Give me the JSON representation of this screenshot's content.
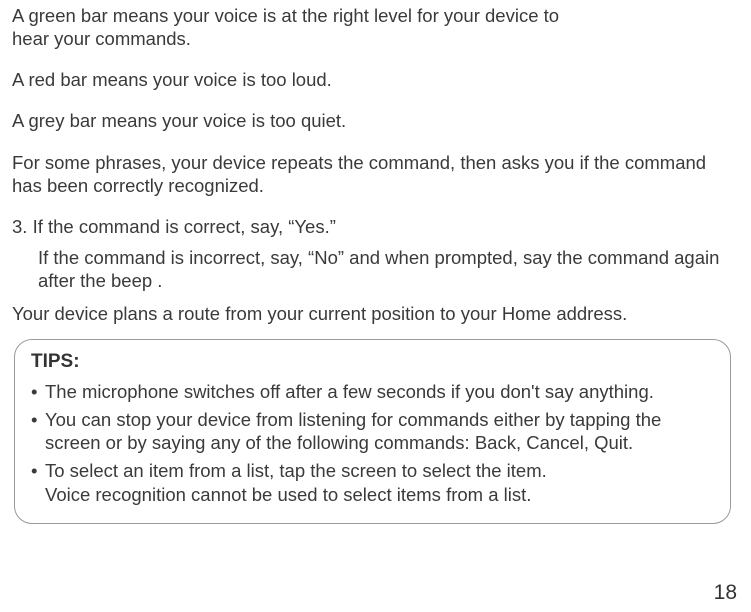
{
  "paragraphs": {
    "green": "A green bar means your voice is at the right level for your device to hear your commands.",
    "red": "A red bar means your voice is too loud.",
    "grey": "A grey bar means your voice is too quiet.",
    "repeat": "For some phrases, your device repeats the command, then asks you if the command has been correctly recognized."
  },
  "step": {
    "line": "3. If the command is correct, say, “Yes.”",
    "sub": "If the command is incorrect, say, “No” and when prompted, say the command again after the beep ."
  },
  "planRoute": "Your device plans a route from your current position to your Home address.",
  "tips": {
    "title": "TIPS:",
    "items": [
      "The microphone switches off after a few seconds if you don't say anything.",
      "You can stop your device from listening for commands either by tapping the screen or by saying any of the following commands: Back, Cancel, Quit.",
      "To select an item from a list, tap the screen to select the item.\nVoice recognition cannot be used to select items from a list."
    ]
  },
  "pageNumber": "18"
}
